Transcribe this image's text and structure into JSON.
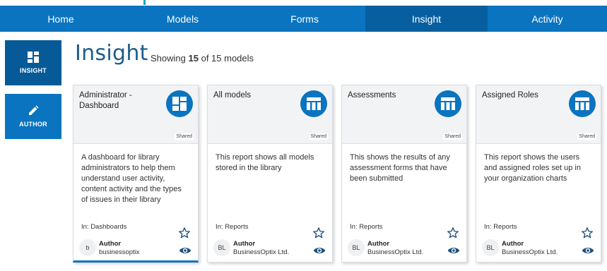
{
  "nav": {
    "items": [
      {
        "label": "Home"
      },
      {
        "label": "Models"
      },
      {
        "label": "Forms"
      },
      {
        "label": "Insight",
        "active": true
      },
      {
        "label": "Activity"
      }
    ]
  },
  "sidebar": {
    "insight_label": "INSIGHT",
    "author_label": "AUTHOR"
  },
  "header": {
    "title": "Insight",
    "showing_prefix": "Showing",
    "shown_count": "15",
    "showing_suffix": "of 15 models"
  },
  "cards": [
    {
      "title": "Administrator - Dashboard",
      "icon": "dashboard-icon",
      "shared": "Shared",
      "description": "A dashboard for library administrators to help them understand user activity, content activity and the types of issues in their library",
      "location": "In: Dashboards",
      "author_label": "Author",
      "author_initials": "b",
      "author_name": "businessoptix"
    },
    {
      "title": "All models",
      "icon": "table-icon",
      "shared": "Shared",
      "description": "This report shows all models stored in the library",
      "location": "In: Reports",
      "author_label": "Author",
      "author_initials": "BL",
      "author_name": "BusinessOptix Ltd."
    },
    {
      "title": "Assessments",
      "icon": "table-icon",
      "shared": "Shared",
      "description": "This shows the results of any assessment forms that have been submitted",
      "location": "In: Reports",
      "author_label": "Author",
      "author_initials": "BL",
      "author_name": "BusinessOptix Ltd."
    },
    {
      "title": "Assigned Roles",
      "icon": "table-icon",
      "shared": "Shared",
      "description": "This report shows the users and assigned roles set up in your organization charts",
      "location": "In: Reports",
      "author_label": "Author",
      "author_initials": "BL",
      "author_name": "BusinessOptix Ltd."
    }
  ],
  "colors": {
    "accent": "#0a74c0",
    "nav_active": "#075f9f",
    "title": "#1d5c8a"
  }
}
